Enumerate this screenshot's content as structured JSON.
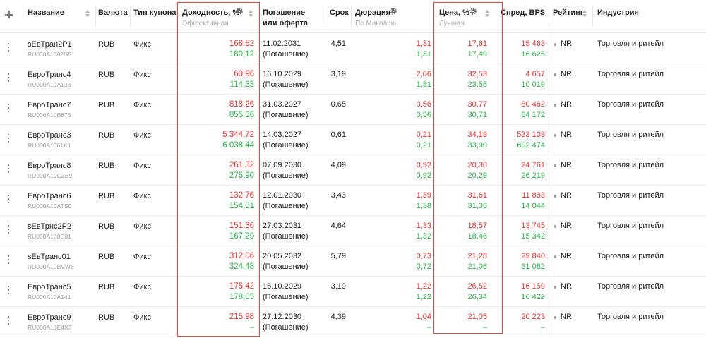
{
  "columns": {
    "name": "Название",
    "currency": "Валюта",
    "coupon_type": "Тип купона",
    "yield": "Доходность, %",
    "yield_sub": "Эффективная",
    "maturity_1": "Погашение",
    "maturity_2": "или оферта",
    "term": "Срок",
    "duration": "Дюрация",
    "duration_sub": "По Маколею",
    "price": "Цена, %",
    "price_sub": "Лучшая",
    "spread": "Спред, BPS",
    "rating": "Рейтинг",
    "industry": "Индустрия"
  },
  "highlight_color": "#d84a4a",
  "colors": {
    "bid": "#e0322f",
    "ask": "#2fae4a",
    "empty": "#a0a0a0"
  },
  "icons": [
    "add-column-icon",
    "sort-icon",
    "gear-icon",
    "row-menu-icon",
    "rating-dot-icon"
  ],
  "rows": [
    {
      "name": "sЕвТран2Р1",
      "isin": "RU000A1082G5",
      "currency": "RUB",
      "coupon": "Фикс.",
      "yield_bid": "168,52",
      "yield_ask": "180,12",
      "date": "11.02.2031",
      "date_note": "(Погашение)",
      "term": "4,51",
      "dur_bid": "1,31",
      "dur_ask": "1,31",
      "price_bid": "17,61",
      "price_ask": "17,49",
      "spread_bid": "15 463",
      "spread_ask": "16 625",
      "rating": "NR",
      "industry": "Торговля и ритейл"
    },
    {
      "name": "ЕвроТранс4",
      "isin": "RU000A10A133",
      "currency": "RUB",
      "coupon": "Фикс.",
      "yield_bid": "60,96",
      "yield_ask": "114,33",
      "date": "16.10.2029",
      "date_note": "(Погашение)",
      "term": "3,19",
      "dur_bid": "2,06",
      "dur_ask": "1,81",
      "price_bid": "32,53",
      "price_ask": "23,55",
      "spread_bid": "4 657",
      "spread_ask": "10 019",
      "rating": "NR",
      "industry": "Торговля и ритейл"
    },
    {
      "name": "ЕвроТранс7",
      "isin": "RU000A10B875",
      "currency": "RUB",
      "coupon": "Фикс.",
      "yield_bid": "818,26",
      "yield_ask": "855,36",
      "date": "31.03.2027",
      "date_note": "(Погашение)",
      "term": "0,65",
      "dur_bid": "0,56",
      "dur_ask": "0,56",
      "price_bid": "30,77",
      "price_ask": "30,71",
      "spread_bid": "80 462",
      "spread_ask": "84 172",
      "rating": "NR",
      "industry": "Торговля и ритейл"
    },
    {
      "name": "ЕвроТранс3",
      "isin": "RU000A1061K1",
      "currency": "RUB",
      "coupon": "Фикс.",
      "yield_bid": "5 344,72",
      "yield_ask": "6 038,44",
      "date": "14.03.2027",
      "date_note": "(Погашение)",
      "term": "0,61",
      "dur_bid": "0,21",
      "dur_ask": "0,21",
      "price_bid": "34,19",
      "price_ask": "33,90",
      "spread_bid": "533 103",
      "spread_ask": "602 474",
      "rating": "NR",
      "industry": "Торговля и ритейл"
    },
    {
      "name": "ЕвроТранс8",
      "isin": "RU000A10CZB9",
      "currency": "RUB",
      "coupon": "Фикс.",
      "yield_bid": "261,32",
      "yield_ask": "275,90",
      "date": "07.09.2030",
      "date_note": "(Погашение)",
      "term": "4,09",
      "dur_bid": "0,92",
      "dur_ask": "0,92",
      "price_bid": "20,30",
      "price_ask": "20,29",
      "spread_bid": "24 761",
      "spread_ask": "26 219",
      "rating": "NR",
      "industry": "Торговля и ритейл"
    },
    {
      "name": "ЕвроТранс6",
      "isin": "RU000A10ATS0",
      "currency": "RUB",
      "coupon": "Фикс.",
      "yield_bid": "132,76",
      "yield_ask": "154,31",
      "date": "12.01.2030",
      "date_note": "(Погашение)",
      "term": "3,43",
      "dur_bid": "1,39",
      "dur_ask": "1,38",
      "price_bid": "31,61",
      "price_ask": "31,36",
      "spread_bid": "11 883",
      "spread_ask": "14 044",
      "rating": "NR",
      "industry": "Торговля и ритейл"
    },
    {
      "name": "sЕвТрнс2Р2",
      "isin": "RU000A108D81",
      "currency": "RUB",
      "coupon": "Фикс.",
      "yield_bid": "151,36",
      "yield_ask": "167,29",
      "date": "27.03.2031",
      "date_note": "(Погашение)",
      "term": "4,64",
      "dur_bid": "1,33",
      "dur_ask": "1,32",
      "price_bid": "18,57",
      "price_ask": "18,46",
      "spread_bid": "13 745",
      "spread_ask": "15 342",
      "rating": "NR",
      "industry": "Торговля и ритейл"
    },
    {
      "name": "sЕвТранс01",
      "isin": "RU000A10BVW6",
      "currency": "RUB",
      "coupon": "Фикс.",
      "yield_bid": "312,06",
      "yield_ask": "324,48",
      "date": "20.05.2032",
      "date_note": "(Погашение)",
      "term": "5,79",
      "dur_bid": "0,73",
      "dur_ask": "0,72",
      "price_bid": "21,28",
      "price_ask": "21,06",
      "spread_bid": "29 840",
      "spread_ask": "31 082",
      "rating": "NR",
      "industry": "Торговля и ритейл"
    },
    {
      "name": "ЕвроТранс5",
      "isin": "RU000A10A141",
      "currency": "RUB",
      "coupon": "Фикс.",
      "yield_bid": "175,42",
      "yield_ask": "178,05",
      "date": "16.10.2029",
      "date_note": "(Погашение)",
      "term": "3,19",
      "dur_bid": "1,22",
      "dur_ask": "1,22",
      "price_bid": "26,52",
      "price_ask": "26,34",
      "spread_bid": "16 159",
      "spread_ask": "16 422",
      "rating": "NR",
      "industry": "Торговля и ритейл"
    },
    {
      "name": "ЕвроТранс9",
      "isin": "RU000A10E4X3",
      "currency": "RUB",
      "coupon": "Фикс.",
      "yield_bid": "215,98",
      "yield_ask": "–",
      "date": "27.12.2030",
      "date_note": "(Погашение)",
      "term": "4,39",
      "dur_bid": "1,04",
      "dur_ask": "–",
      "price_bid": "21,05",
      "price_ask": "–",
      "spread_bid": "20 223",
      "spread_ask": "–",
      "rating": "NR",
      "industry": "Торговля и ритейл"
    }
  ]
}
